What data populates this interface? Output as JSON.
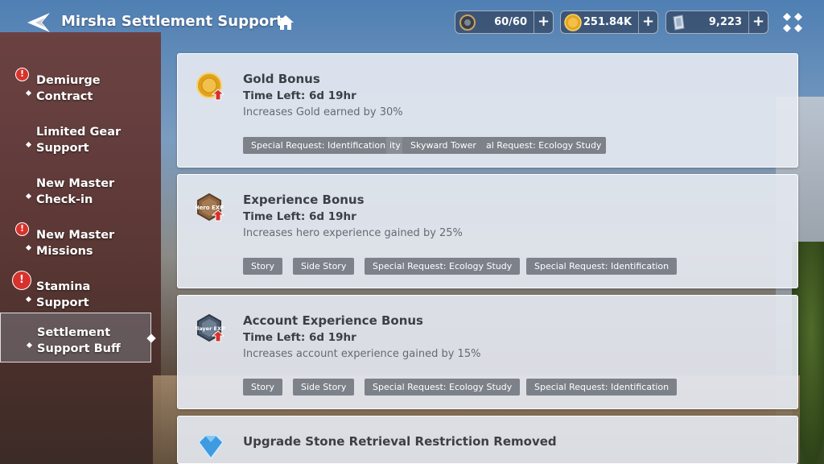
{
  "header": {
    "title": "Mirsha Settlement Support"
  },
  "resources": [
    {
      "icon": "gear-currency-icon",
      "value": "60/60"
    },
    {
      "icon": "gold-coin-icon",
      "value": "251.84K"
    },
    {
      "icon": "crystal-card-icon",
      "value": "9,223"
    }
  ],
  "sidebar": {
    "items": [
      {
        "label": "Demiurge\nContract",
        "alert": "!"
      },
      {
        "label": "Limited Gear\nSupport"
      },
      {
        "label": "New Master\nCheck-in"
      },
      {
        "label": "New Master\nMissions",
        "alert": "!"
      },
      {
        "label": "Stamina\nSupport",
        "alert": "!"
      },
      {
        "label": "Settlement\nSupport Buff",
        "active": true
      }
    ]
  },
  "cards": [
    {
      "icon": "gold-bonus-icon",
      "title": "Gold Bonus",
      "time": "Time Left: 6d 19hr",
      "desc": "Increases Gold earned by 30%",
      "tags": [
        "Special Request: Identification",
        "ity",
        "Skyward Tower",
        "al Request: Ecology Study"
      ]
    },
    {
      "icon": "hero-exp-icon",
      "icon_text": "Hero EXP",
      "title": "Experience Bonus",
      "time": "Time Left: 6d 19hr",
      "desc": "Increases hero experience gained by 25%",
      "tags": [
        "Story",
        "Side Story",
        "Special Request: Ecology Study",
        "Special Request: Identification"
      ]
    },
    {
      "icon": "player-exp-icon",
      "icon_text": "Player EXP",
      "title": "Account Experience Bonus",
      "time": "Time Left: 6d 19hr",
      "desc": "Increases account experience gained by 15%",
      "tags": [
        "Story",
        "Side Story",
        "Special Request: Ecology Study",
        "Special Request: Identification"
      ]
    },
    {
      "icon": "upgrade-stone-icon",
      "title": "Upgrade Stone Retrieval Restriction Removed"
    }
  ]
}
